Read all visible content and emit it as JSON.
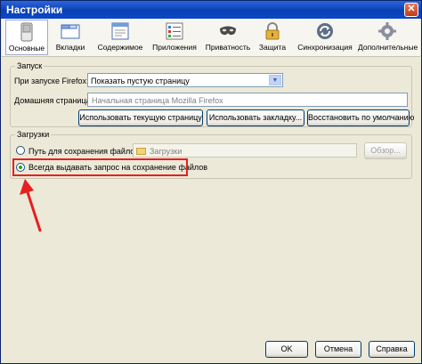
{
  "window": {
    "title": "Настройки",
    "close_glyph": "✕"
  },
  "toolbar": {
    "items": [
      {
        "label": "Основные",
        "icon": "switch-icon"
      },
      {
        "label": "Вкладки",
        "icon": "tabs-window-icon"
      },
      {
        "label": "Содержимое",
        "icon": "content-page-icon"
      },
      {
        "label": "Приложения",
        "icon": "applications-list-icon"
      },
      {
        "label": "Приватность",
        "icon": "privacy-mask-icon"
      },
      {
        "label": "Защита",
        "icon": "padlock-icon"
      },
      {
        "label": "Синхронизация",
        "icon": "sync-arrows-icon"
      },
      {
        "label": "Дополнительные",
        "icon": "gear-icon"
      }
    ],
    "active_index": 0
  },
  "startup": {
    "group_title": "Запуск",
    "on_start_label": "При запуске Firefox:",
    "on_start_value": "Показать пустую страницу",
    "homepage_label": "Домашняя страница:",
    "homepage_placeholder": "Начальная страница Mozilla Firefox",
    "use_current_label": "Использовать текущую страницу",
    "use_bookmark_label": "Использовать закладку...",
    "restore_default_label": "Восстановить по умолчанию"
  },
  "downloads": {
    "group_title": "Загрузки",
    "save_path_label": "Путь для сохранения файлов",
    "folder_value": "Загрузки",
    "browse_label": "Обзор...",
    "always_ask_label": "Всегда выдавать запрос на сохранение файлов",
    "selected": "always_ask"
  },
  "footer": {
    "ok_label": "OK",
    "cancel_label": "Отмена",
    "help_label": "Справка"
  },
  "colors": {
    "annotation_red": "#e52020",
    "title_bar_blue": "#0a3fb6"
  }
}
